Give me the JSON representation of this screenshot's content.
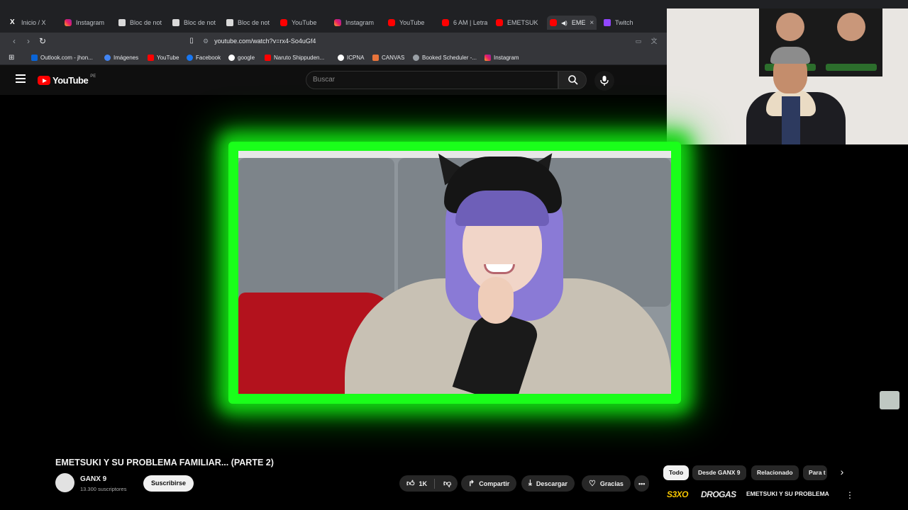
{
  "browser": {
    "tabs": [
      {
        "label": "Inicio / X",
        "icon": "x-icon"
      },
      {
        "label": "Instagram",
        "icon": "instagram-icon"
      },
      {
        "label": "Bloc de not",
        "icon": "note-icon"
      },
      {
        "label": "Bloc de not",
        "icon": "note-icon"
      },
      {
        "label": "Bloc de not",
        "icon": "note-icon"
      },
      {
        "label": "YouTube",
        "icon": "youtube-icon"
      },
      {
        "label": "Instagram",
        "icon": "instagram-icon"
      },
      {
        "label": "YouTube",
        "icon": "youtube-icon"
      },
      {
        "label": "6 AM | Letra",
        "icon": "youtube-icon"
      },
      {
        "label": "EMETSUKI Y",
        "icon": "youtube-icon"
      },
      {
        "label": "EME",
        "icon": "youtube-icon"
      },
      {
        "label": "Twitch",
        "icon": "twitch-icon"
      }
    ],
    "active_tab_close": "×",
    "url": "youtube.com/watch?v=rx4-So4uGf4",
    "bookmarks": [
      {
        "label": "Outlook.com - jhon...",
        "color": "#0a64d6"
      },
      {
        "label": "Imágenes",
        "color": "#4285f4"
      },
      {
        "label": "YouTube",
        "color": "#ff0000"
      },
      {
        "label": "Facebook",
        "color": "#1877f2"
      },
      {
        "label": "google",
        "color": "#ffffff"
      },
      {
        "label": "Naruto Shippuden...",
        "color": "#ff0000"
      },
      {
        "label": "ICPNA",
        "color": "#ffffff"
      },
      {
        "label": "CANVAS",
        "color": "#e8743b"
      },
      {
        "label": "Booked Scheduler -...",
        "color": "#9aa0a6"
      },
      {
        "label": "Instagram",
        "color": "#e91e63"
      }
    ]
  },
  "youtube": {
    "logo_text": "YouTube",
    "country_code": "PE",
    "search_placeholder": "Buscar",
    "video_title": "EMETSUKI Y SU PROBLEMA FAMILIAR... (PARTE 2)",
    "channel_name": "GANX 9",
    "subscribers": "13.300 suscriptores",
    "subscribe_label": "Suscribirse",
    "like_count": "1K",
    "share_label": "Compartir",
    "download_label": "Descargar",
    "thanks_label": "Gracias",
    "more_label": "•••",
    "chips": [
      "Todo",
      "Desde GANX 9",
      "Relacionado",
      "Para t"
    ],
    "rec_brand_1": "S3XO",
    "rec_brand_2": "DROGAS",
    "rec_title": "EMETSUKI Y SU PROBLEMA",
    "rec_more": "⋮"
  },
  "colors": {
    "glow": "#1aff1a",
    "youtube_red": "#ff0000",
    "background": "#0f0f0f"
  }
}
